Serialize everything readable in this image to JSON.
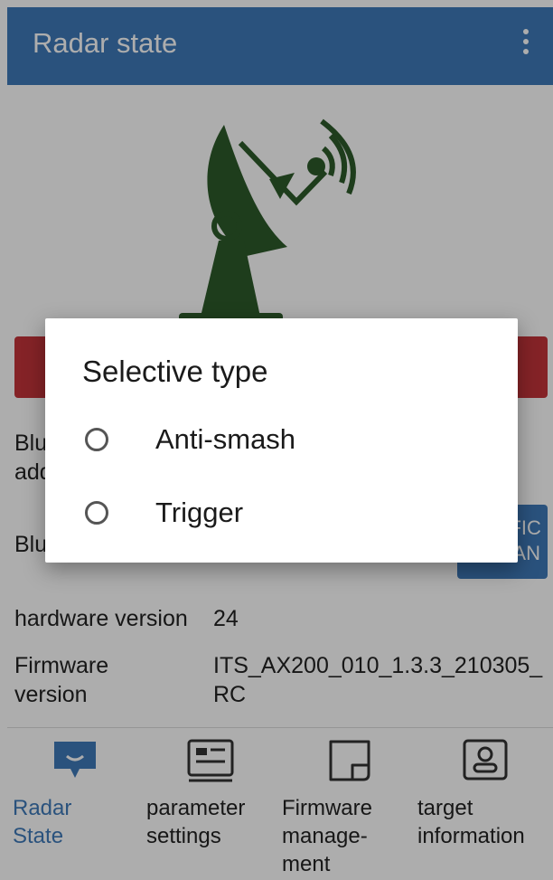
{
  "appbar": {
    "title": "Radar state",
    "menu_icon": "more-vertical-icon"
  },
  "radar_icon": "radar-dish-icon",
  "colors": {
    "primary": "#3f7ab9",
    "alert": "#c5343a",
    "radar": "#2d5a2a"
  },
  "info": {
    "bluetooth_address_label": "Bluetooth address",
    "bluetooth_label": "Blu",
    "button_label": "TRAFFIC\nSCAN",
    "hardware_label": "hardware version",
    "hardware_value": "24",
    "firmware_label": "Firmware\nversion",
    "firmware_value": "ITS_AX200_010_1.3.3_210305_\nRC"
  },
  "nav": {
    "items": [
      {
        "label": "Radar State",
        "icon": "chat-bubble-icon",
        "active": true
      },
      {
        "label": "parameter\nsettings",
        "icon": "settings-card-icon"
      },
      {
        "label": "Firmware\nmanage-\nment",
        "icon": "firmware-box-icon"
      },
      {
        "label": "target\ninformation",
        "icon": "id-card-icon"
      }
    ]
  },
  "dialog": {
    "title": "Selective type",
    "options": [
      {
        "label": "Anti-smash",
        "selected": false
      },
      {
        "label": "Trigger",
        "selected": false
      }
    ]
  }
}
